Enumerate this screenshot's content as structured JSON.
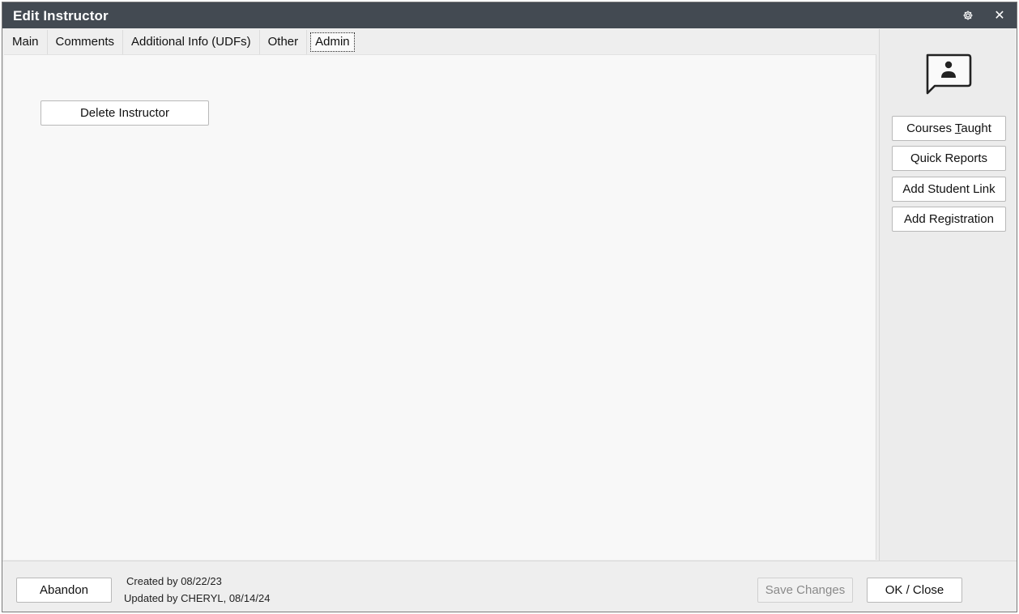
{
  "window": {
    "title": "Edit Instructor",
    "settings_icon": "gear-icon",
    "close_icon": "close-icon",
    "close_glyph": "✕"
  },
  "tabs": [
    {
      "label": "Main",
      "active": false
    },
    {
      "label": "Comments",
      "active": false
    },
    {
      "label": "Additional Info (UDFs)",
      "active": false
    },
    {
      "label": "Other",
      "active": false
    },
    {
      "label": "Admin",
      "active": true
    }
  ],
  "admin": {
    "delete_label": "Delete Instructor"
  },
  "side_panel": {
    "avatar_icon": "person-speech-bubble-icon",
    "buttons": [
      {
        "label": "Courses Taught",
        "accelerator": "T"
      },
      {
        "label": "Quick Reports"
      },
      {
        "label": "Add Student Link"
      },
      {
        "label": "Add Registration"
      }
    ]
  },
  "footer": {
    "abandon_label": "Abandon",
    "created_text": "Created by 08/22/23",
    "updated_text": "Updated by CHERYL, 08/14/24",
    "save_label": "Save Changes",
    "save_enabled": false,
    "ok_label": "OK / Close"
  },
  "colors": {
    "titlebar": "#434a52",
    "content_bg": "#f8f8f8",
    "panel_bg": "#ececec",
    "disabled_text": "#8a8a8a"
  }
}
